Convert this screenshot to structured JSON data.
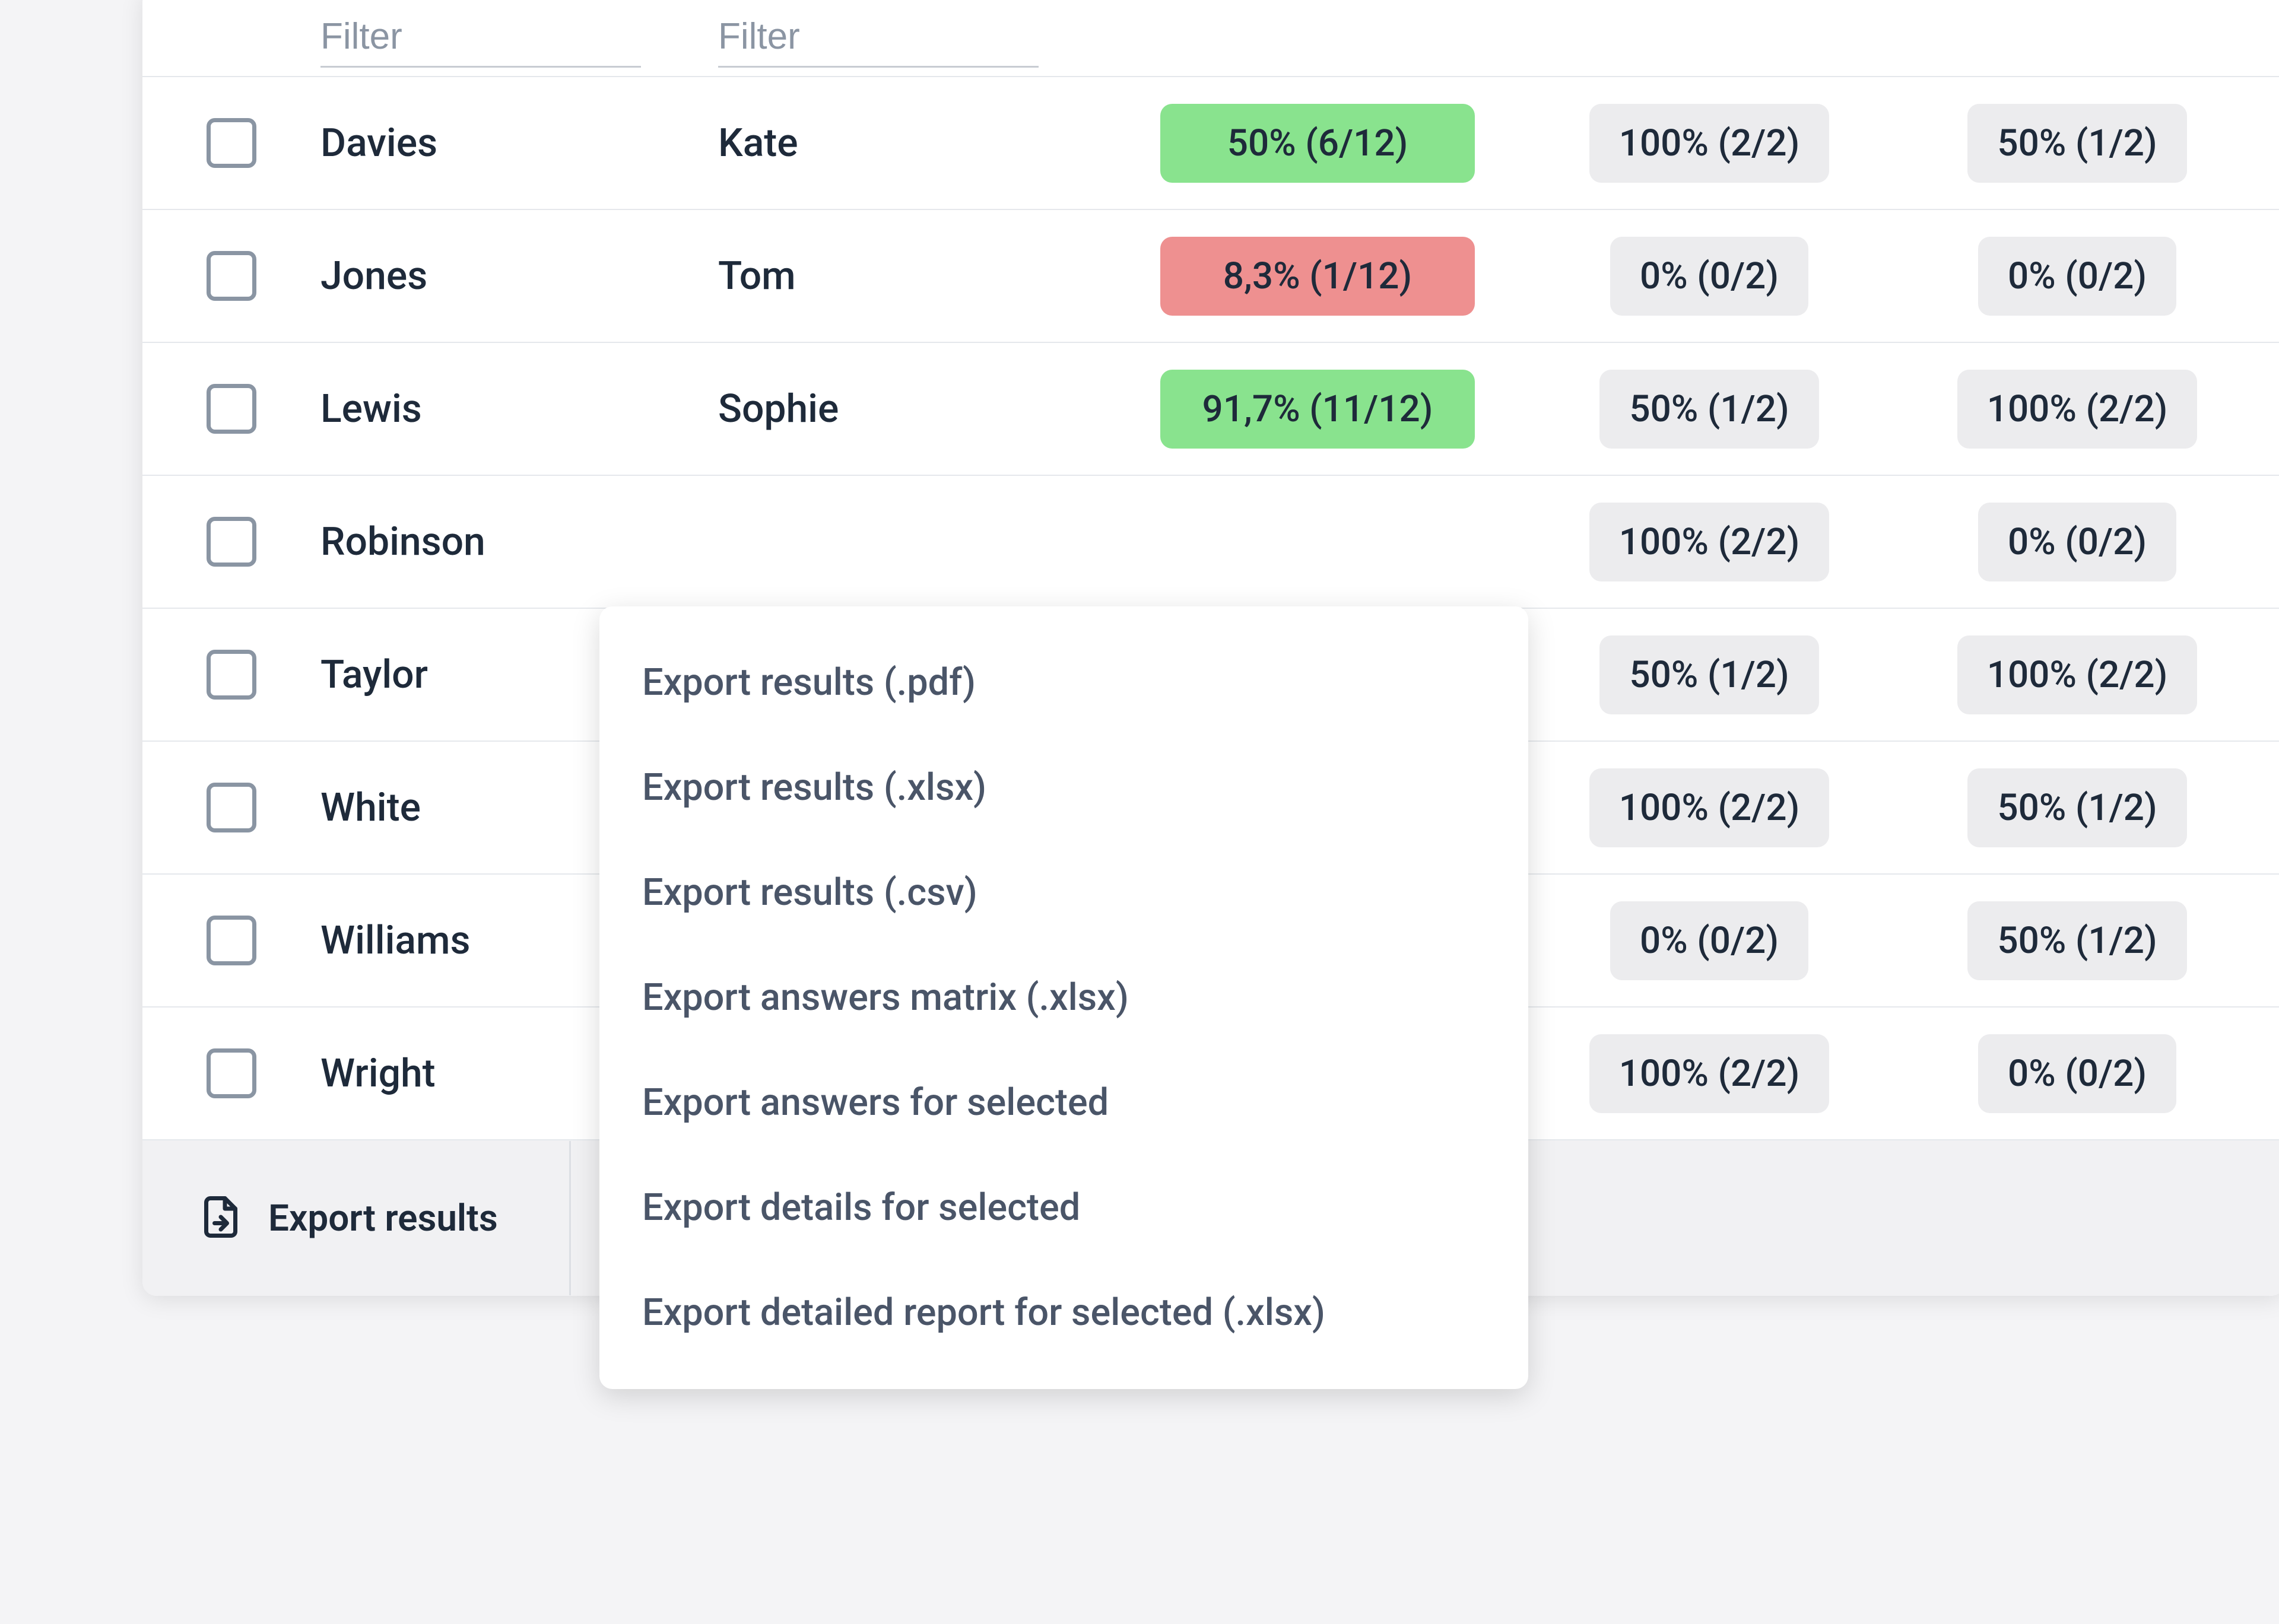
{
  "filter": {
    "placeholder": "Filter"
  },
  "rows": [
    {
      "last": "Davies",
      "first": "Kate",
      "s1": {
        "text": "50% (6/12)",
        "tone": "green"
      },
      "s2": {
        "text": "100% (2/2)",
        "tone": "grey"
      },
      "s3": {
        "text": "50% (1/2)",
        "tone": "grey"
      }
    },
    {
      "last": "Jones",
      "first": "Tom",
      "s1": {
        "text": "8,3% (1/12)",
        "tone": "red"
      },
      "s2": {
        "text": "0% (0/2)",
        "tone": "grey"
      },
      "s3": {
        "text": "0% (0/2)",
        "tone": "grey"
      }
    },
    {
      "last": "Lewis",
      "first": "Sophie",
      "s1": {
        "text": "91,7% (11/12)",
        "tone": "green"
      },
      "s2": {
        "text": "50% (1/2)",
        "tone": "grey"
      },
      "s3": {
        "text": "100% (2/2)",
        "tone": "grey"
      }
    },
    {
      "last": "Robinson",
      "first": "",
      "s1": {
        "text": "",
        "tone": "hidden"
      },
      "s2": {
        "text": "100% (2/2)",
        "tone": "grey"
      },
      "s3": {
        "text": "0% (0/2)",
        "tone": "grey"
      }
    },
    {
      "last": "Taylor",
      "first": "",
      "s1": {
        "text": "",
        "tone": "hidden"
      },
      "s2": {
        "text": "50% (1/2)",
        "tone": "grey"
      },
      "s3": {
        "text": "100% (2/2)",
        "tone": "grey"
      }
    },
    {
      "last": "White",
      "first": "",
      "s1": {
        "text": "",
        "tone": "hidden"
      },
      "s2": {
        "text": "100% (2/2)",
        "tone": "grey"
      },
      "s3": {
        "text": "50% (1/2)",
        "tone": "grey"
      }
    },
    {
      "last": "Williams",
      "first": "",
      "s1": {
        "text": "",
        "tone": "hidden"
      },
      "s2": {
        "text": "0% (0/2)",
        "tone": "grey"
      },
      "s3": {
        "text": "50% (1/2)",
        "tone": "grey"
      }
    },
    {
      "last": "Wright",
      "first": "",
      "s1": {
        "text": "",
        "tone": "hidden"
      },
      "s2": {
        "text": "100% (2/2)",
        "tone": "grey"
      },
      "s3": {
        "text": "0% (0/2)",
        "tone": "grey"
      }
    }
  ],
  "footer": {
    "export_label": "Export results"
  },
  "menu": {
    "items": [
      "Export results (.pdf)",
      "Export results (.xlsx)",
      "Export results (.csv)",
      "Export answers matrix (.xlsx)",
      "Export answers for selected",
      "Export details for selected",
      "Export detailed report for selected (.xlsx)"
    ]
  }
}
